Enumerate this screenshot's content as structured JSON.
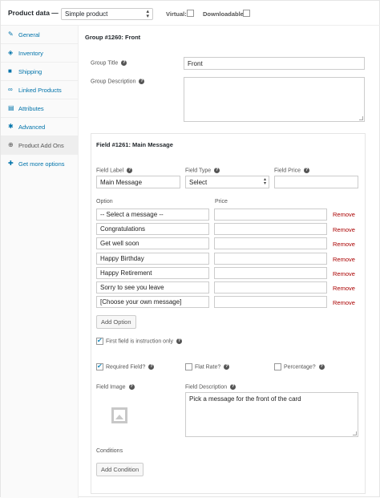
{
  "header": {
    "title": "Product data —",
    "product_type": "Simple product",
    "virtual_label": "Virtual:",
    "downloadable_label": "Downloadable:"
  },
  "sidebar": {
    "items": [
      {
        "label": "General",
        "icon": "wrench-icon"
      },
      {
        "label": "Inventory",
        "icon": "tag-icon"
      },
      {
        "label": "Shipping",
        "icon": "truck-icon"
      },
      {
        "label": "Linked Products",
        "icon": "link-icon"
      },
      {
        "label": "Attributes",
        "icon": "list-icon"
      },
      {
        "label": "Advanced",
        "icon": "gear-icon"
      },
      {
        "label": "Product Add Ons",
        "icon": "plus-circle-icon",
        "active": true
      },
      {
        "label": "Get more options",
        "icon": "plugin-icon"
      }
    ]
  },
  "group": {
    "heading": "Group #1260: Front",
    "title_label": "Group Title",
    "title_value": "Front",
    "description_label": "Group Description",
    "description_value": ""
  },
  "field": {
    "heading": "Field #1261: Main Message",
    "label_label": "Field Label",
    "label_value": "Main Message",
    "type_label": "Field Type",
    "type_value": "Select",
    "price_label": "Field Price",
    "price_value": "",
    "option_header": "Option",
    "price_header": "Price",
    "remove_label": "Remove",
    "options": [
      {
        "name": "-- Select a message --",
        "price": ""
      },
      {
        "name": "Congratulations",
        "price": ""
      },
      {
        "name": "Get well soon",
        "price": ""
      },
      {
        "name": "Happy Birthday",
        "price": ""
      },
      {
        "name": "Happy Retirement",
        "price": ""
      },
      {
        "name": "Sorry to see you leave",
        "price": ""
      },
      {
        "name": "[Choose your own message]",
        "price": ""
      }
    ],
    "add_option_label": "Add Option",
    "first_instruction_label": "First field is instruction only",
    "first_instruction_checked": true,
    "required_label": "Required Field?",
    "required_checked": true,
    "flat_rate_label": "Flat Rate?",
    "flat_rate_checked": false,
    "percentage_label": "Percentage?",
    "percentage_checked": false,
    "image_label": "Field Image",
    "description_label": "Field Description",
    "description_value": "Pick a message for the front of the card",
    "conditions_label": "Conditions",
    "add_condition_label": "Add Condition"
  },
  "colors": {
    "link": "#0073aa",
    "remove": "#aa0000",
    "checkmark": "#1e8cbe"
  }
}
